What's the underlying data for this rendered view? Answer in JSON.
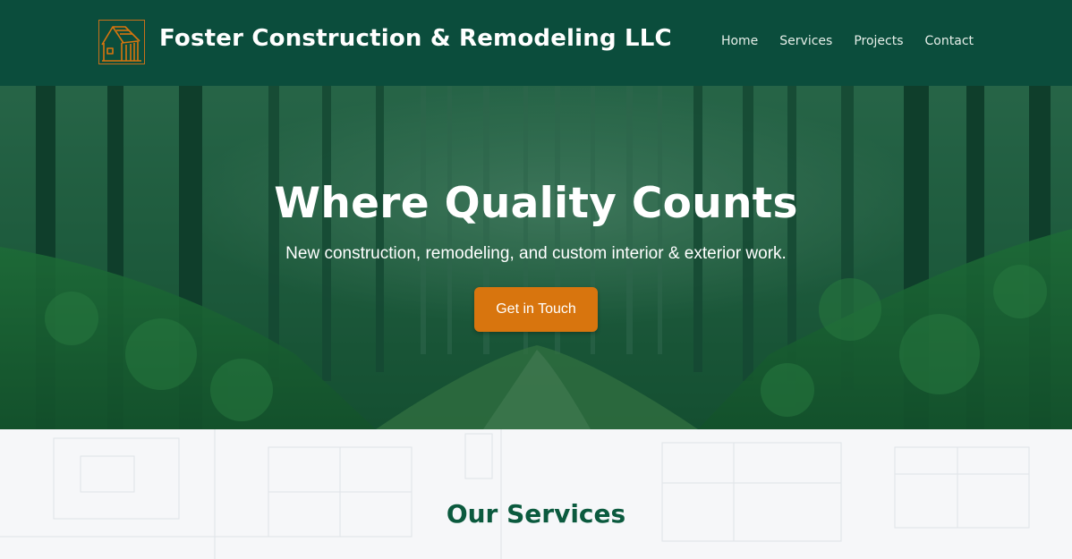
{
  "header": {
    "site_title": "Foster Construction & Remodeling LLC",
    "logo_icon": "house-frame-logo",
    "nav": {
      "home": "Home",
      "services": "Services",
      "projects": "Projects",
      "contact": "Contact"
    }
  },
  "hero": {
    "heading": "Where Quality Counts",
    "subheading": "New construction, remodeling, and custom interior & exterior work.",
    "cta_label": "Get in Touch",
    "background": "forest-image"
  },
  "services": {
    "heading": "Our Services",
    "background": "blueprint-pattern"
  },
  "colors": {
    "header_bg": "#0b4d3c",
    "accent": "#d8750e",
    "heading_green": "#0b5a3e",
    "section_bg": "#f6f7f9"
  }
}
